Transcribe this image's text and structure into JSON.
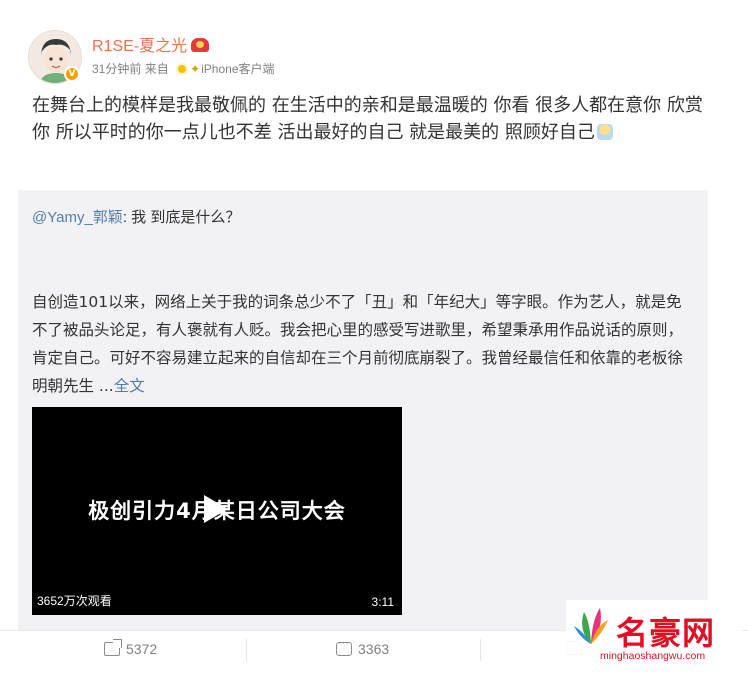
{
  "post": {
    "author": "R1SE-夏之光",
    "time": "31分钟前",
    "source_prefix": "来自",
    "source": "iPhone客户端",
    "text": "在舞台上的模样是我最敬佩的 在生活中的亲和是最温暖的 你看 很多人都在意你 欣赏你 所以平时的你一点儿也不差 活出最好的自己 就是最美的 照顾好自己"
  },
  "repost": {
    "mention": "@Yamy_郭颖",
    "title_rest": ": 我 到底是什么？",
    "body": "自创造101以来，网络上关于我的词条总少不了「丑」和「年纪大」等字眼。作为艺人，就是免不了被品头论足，有人褒就有人贬。我会把心里的感受写进歌里，希望秉承用作品说话的原则，肯定自己。可好不容易建立起来的自信却在三个月前彻底崩裂了。我曾经最信任和依靠的老板徐明朝先生 ...",
    "more_label": "全文",
    "video": {
      "title": "极创引力4月某日公司大会",
      "views": "3652万次观看",
      "duration": "3:11"
    }
  },
  "actions": {
    "share_count": "5372",
    "comment_count": "3363"
  },
  "watermark": {
    "brand": "名豪网",
    "url": "minghaoshangwu.com"
  },
  "colors": {
    "username": "#eb7350",
    "link": "#507daf",
    "card_bg": "#f2f2f5",
    "watermark_red": "#e10e24"
  },
  "icons": [
    "avatar",
    "verified-badge-icon",
    "vip-badge-icon",
    "sun-badge-icon",
    "share-icon",
    "comment-icon",
    "like-icon",
    "play-icon",
    "leaf-logo-icon"
  ]
}
